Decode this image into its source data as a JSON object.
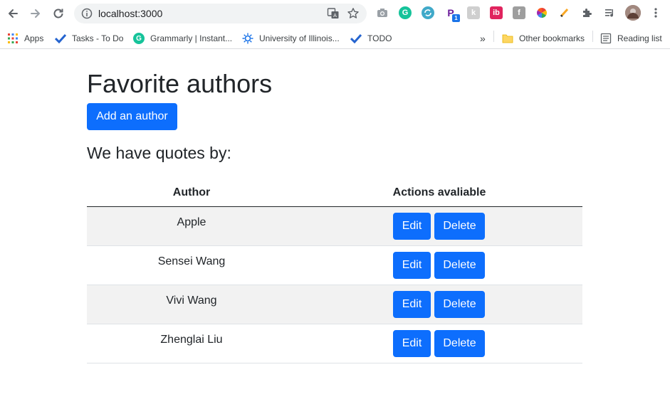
{
  "browser": {
    "url": "localhost:3000",
    "bookmarks": [
      {
        "label": "Apps"
      },
      {
        "label": "Tasks - To Do"
      },
      {
        "label": "Grammarly | Instant..."
      },
      {
        "label": "University of Illinois..."
      },
      {
        "label": "TODO"
      }
    ],
    "more_bookmarks": "»",
    "other_bookmarks": "Other bookmarks",
    "reading_list": "Reading list",
    "extension_badge": "1"
  },
  "page": {
    "title": "Favorite authors",
    "add_button": "Add an author",
    "subtitle": "We have quotes by:",
    "table": {
      "headers": [
        "Author",
        "Actions avaliable"
      ],
      "rows": [
        {
          "author": "Apple",
          "edit": "Edit",
          "delete": "Delete"
        },
        {
          "author": "Sensei Wang",
          "edit": "Edit",
          "delete": "Delete"
        },
        {
          "author": "Vivi Wang",
          "edit": "Edit",
          "delete": "Delete"
        },
        {
          "author": "Zhenglai Liu",
          "edit": "Edit",
          "delete": "Delete"
        }
      ]
    }
  },
  "colors": {
    "primary": "#0d6efd",
    "stripe": "#f2f2f2",
    "text": "#212529"
  }
}
